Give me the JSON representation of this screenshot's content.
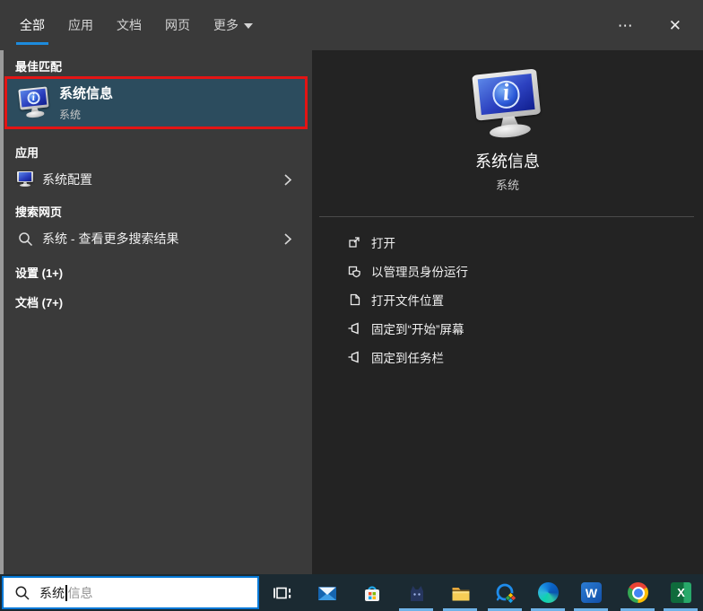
{
  "window": {
    "more_icon": "⋯",
    "close_icon": "✕"
  },
  "tabs": {
    "all": "全部",
    "apps": "应用",
    "docs": "文档",
    "web": "网页",
    "more": "更多"
  },
  "left": {
    "header_best": "最佳匹配",
    "best_title": "系统信息",
    "best_sub": "系统",
    "header_apps": "应用",
    "app_item": "系统配置",
    "header_web": "搜索网页",
    "web_item": "系统 - 查看更多搜索结果",
    "header_settings": "设置 (1+)",
    "header_docs": "文档 (7+)"
  },
  "right": {
    "title": "系统信息",
    "subtitle": "系统",
    "actions": [
      {
        "label": "打开",
        "icon": "open-icon"
      },
      {
        "label": "以管理员身份运行",
        "icon": "run-as-admin-shield-icon"
      },
      {
        "label": "打开文件位置",
        "icon": "open-file-location-icon"
      },
      {
        "label": "固定到“开始”屏幕",
        "icon": "pin-to-start-icon"
      },
      {
        "label": "固定到任务栏",
        "icon": "pin-to-taskbar-icon"
      }
    ]
  },
  "taskbar": {
    "search_typed": "系统",
    "search_suggestion": "信息",
    "apps": [
      "task-view",
      "mail",
      "microsoft-store",
      "cat-app",
      "file-explorer",
      "qq-chat",
      "edge",
      "word",
      "chrome",
      "excel"
    ],
    "running_apps": [
      "cat-app",
      "file-explorer",
      "qq-chat",
      "edge",
      "word",
      "chrome",
      "excel"
    ]
  },
  "icons": {
    "word_letter": "W",
    "excel_letter": "X",
    "info_letter": "i"
  },
  "colors": {
    "accent": "#0078d7",
    "best_match_highlight": "#2c4c5e",
    "annotation_red": "#e31414",
    "taskbar_bg": "#1b2a32",
    "tab_underline": "#1d8bdd",
    "running_indicator": "#6fb3e8"
  }
}
